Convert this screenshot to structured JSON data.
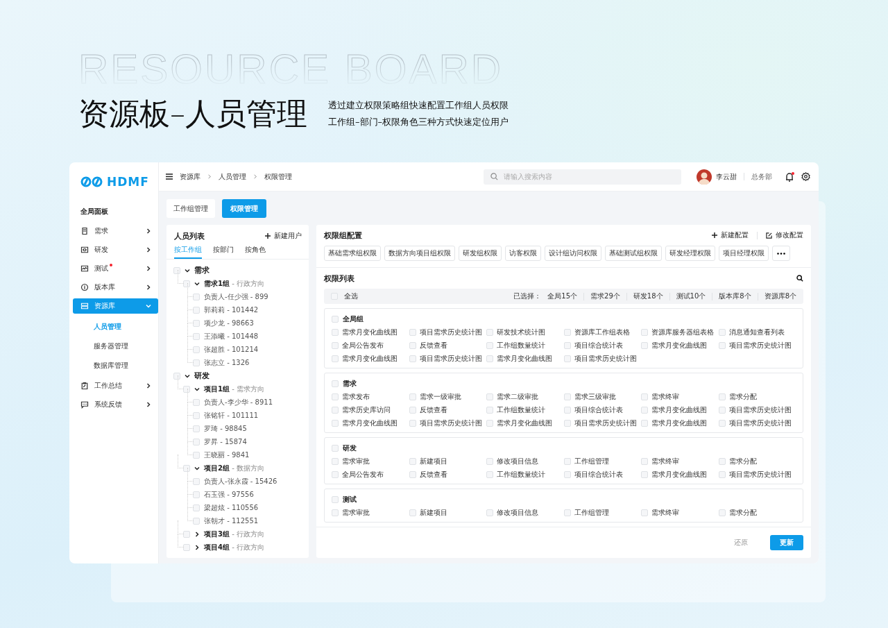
{
  "hero": {
    "backdrop_text": "RESOURCE BOARD",
    "title": "资源板–人员管理",
    "subtitle_lines": [
      "透过建立权限策略组快速配置工作组人员权限",
      "工作组–部门–权限角色三种方式快速定位用户"
    ]
  },
  "sidebar": {
    "logo": "HDMF",
    "heading": "全局面板",
    "items": [
      {
        "label": "需求",
        "dot": false,
        "selected": false,
        "expanded": false
      },
      {
        "label": "研发",
        "dot": false,
        "selected": false,
        "expanded": false
      },
      {
        "label": "测试",
        "dot": true,
        "selected": false,
        "expanded": false
      },
      {
        "label": "版本库",
        "dot": false,
        "selected": false,
        "expanded": false
      },
      {
        "label": "资源库",
        "dot": false,
        "selected": true,
        "expanded": true,
        "children": [
          {
            "label": "人员管理",
            "selected": true
          },
          {
            "label": "服务器管理",
            "selected": false
          },
          {
            "label": "数据库管理",
            "selected": false
          }
        ]
      },
      {
        "label": "工作总结",
        "dot": false,
        "selected": false,
        "expanded": false
      },
      {
        "label": "系统反馈",
        "dot": false,
        "selected": false,
        "expanded": false
      }
    ]
  },
  "header": {
    "breadcrumb": [
      "资源库",
      "人员管理",
      "权限管理"
    ],
    "search": {
      "placeholder": "请输入搜索内容"
    },
    "user": {
      "name": "李云甜",
      "department": "总务部"
    },
    "notifications_unread": true
  },
  "page_tabs": [
    {
      "label": "工作组管理",
      "selected": false
    },
    {
      "label": "权限管理",
      "selected": true
    }
  ],
  "people": {
    "title": "人员列表",
    "action": "新建用户",
    "tabs": [
      {
        "label": "按工作组",
        "selected": true
      },
      {
        "label": "按部门",
        "selected": false
      },
      {
        "label": "按角色",
        "selected": false
      }
    ],
    "tree": [
      {
        "label": "需求",
        "checked": false,
        "expanded": true,
        "children": [
          {
            "label": "**需求1组** - 行政方向",
            "checked": false,
            "expanded": true,
            "children": [
              {
                "label": "负责人-任少强 - 899",
                "checked": false
              },
              {
                "label": "郭莉莉 - 101442",
                "checked": false
              },
              {
                "label": "项少龙 - 98663",
                "checked": false
              },
              {
                "label": "王添曦 - 101448",
                "checked": false
              },
              {
                "label": "张超胜 - 101214",
                "checked": false
              },
              {
                "label": "张志立 - 1326",
                "checked": false
              }
            ]
          }
        ]
      },
      {
        "label": "研发",
        "checked": false,
        "expanded": true,
        "children": [
          {
            "label": "**项目1组** - 需求方向",
            "checked": false,
            "expanded": true,
            "children": [
              {
                "label": "负责人-李少华 - 8911",
                "checked": false
              },
              {
                "label": "张铭轩 - 101111",
                "checked": false
              },
              {
                "label": "罗琦 - 98845",
                "checked": false
              },
              {
                "label": "罗昇 - 15874",
                "checked": false
              },
              {
                "label": "王晓丽 - 9841",
                "checked": false
              }
            ]
          },
          {
            "label": "**项目2组** - 数据方向",
            "checked": false,
            "expanded": true,
            "children": [
              {
                "label": "负责人-张永霞 - 15426",
                "checked": false
              },
              {
                "label": "石玉强 - 97556",
                "checked": false
              },
              {
                "label": "梁超炫 - 110556",
                "checked": false
              },
              {
                "label": "张朝才 - 112551",
                "checked": false
              }
            ]
          },
          {
            "label": "**项目3组** - 行政方向",
            "checked": false,
            "expanded": false
          },
          {
            "label": "**项目4组** - 行政方向",
            "checked": false,
            "expanded": false
          }
        ]
      }
    ]
  },
  "permissions": {
    "title": "权限组配置",
    "actions": [
      "新建配置",
      "修改配置"
    ],
    "groups": [
      "基础需求组权限",
      "数据方向项目组权限",
      "研发组权限",
      "访客权限",
      "设计组访问权限",
      "基础测试组权限",
      "研发经理权限",
      "项目经理权限"
    ],
    "list_title": "权限列表",
    "select_all": {
      "label": "全选",
      "checked": false
    },
    "selected_label": "已选择：",
    "counts": [
      "全局15个",
      "需求29个",
      "研发18个",
      "测试10个",
      "版本库8个",
      "资源库8个"
    ],
    "sections": [
      {
        "title": "全局组",
        "checked": false,
        "items": [
          {
            "label": "需求月变化曲线图",
            "checked": false
          },
          {
            "label": "项目需求历史统计图",
            "checked": false
          },
          {
            "label": "研发技术统计图",
            "checked": false
          },
          {
            "label": "资源库工作组表格",
            "checked": false
          },
          {
            "label": "资源库服务器组表格",
            "checked": false
          },
          {
            "label": "消息通知查看列表",
            "checked": false
          },
          {
            "label": "全局公告发布",
            "checked": false
          },
          {
            "label": "反馈查看",
            "checked": false
          },
          {
            "label": "工作组数量统计",
            "checked": false
          },
          {
            "label": "项目综合统计表",
            "checked": false
          },
          {
            "label": "需求月变化曲线图",
            "checked": false
          },
          {
            "label": "项目需求历史统计图",
            "checked": false
          },
          {
            "label": "需求月变化曲线图",
            "checked": false
          },
          {
            "label": "项目需求历史统计图",
            "checked": false
          },
          {
            "label": "需求月变化曲线图",
            "checked": false
          },
          {
            "label": "项目需求历史统计图",
            "checked": false
          }
        ]
      },
      {
        "title": "需求",
        "checked": false,
        "items": [
          {
            "label": "需求发布",
            "checked": false
          },
          {
            "label": "需求一级审批",
            "checked": false
          },
          {
            "label": "需求二级审批",
            "checked": false
          },
          {
            "label": "需求三级审批",
            "checked": false
          },
          {
            "label": "需求终审",
            "checked": false
          },
          {
            "label": "需求分配",
            "checked": false
          },
          {
            "label": "需求历史库访问",
            "checked": false
          },
          {
            "label": "反馈查看",
            "checked": false
          },
          {
            "label": "工作组数量统计",
            "checked": false
          },
          {
            "label": "项目综合统计表",
            "checked": false
          },
          {
            "label": "需求月变化曲线图",
            "checked": false
          },
          {
            "label": "项目需求历史统计图",
            "checked": false
          },
          {
            "label": "需求月变化曲线图",
            "checked": false
          },
          {
            "label": "项目需求历史统计图",
            "checked": false
          },
          {
            "label": "需求月变化曲线图",
            "checked": false
          },
          {
            "label": "项目需求历史统计图",
            "checked": false
          },
          {
            "label": "需求月变化曲线图",
            "checked": false
          },
          {
            "label": "项目需求历史统计图",
            "checked": false
          }
        ]
      },
      {
        "title": "研发",
        "checked": false,
        "items": [
          {
            "label": "需求审批",
            "checked": false
          },
          {
            "label": "新建项目",
            "checked": false
          },
          {
            "label": "修改项目信息",
            "checked": false
          },
          {
            "label": "工作组管理",
            "checked": false
          },
          {
            "label": "需求终审",
            "checked": false
          },
          {
            "label": "需求分配",
            "checked": false
          },
          {
            "label": "全局公告发布",
            "checked": false
          },
          {
            "label": "反馈查看",
            "checked": false
          },
          {
            "label": "工作组数量统计",
            "checked": false
          },
          {
            "label": "项目综合统计表",
            "checked": false
          },
          {
            "label": "需求月变化曲线图",
            "checked": false
          },
          {
            "label": "项目需求历史统计图",
            "checked": false
          }
        ]
      },
      {
        "title": "测试",
        "checked": false,
        "items": [
          {
            "label": "需求审批",
            "checked": false
          },
          {
            "label": "新建项目",
            "checked": false
          },
          {
            "label": "修改项目信息",
            "checked": false
          },
          {
            "label": "工作组管理",
            "checked": false
          },
          {
            "label": "需求终审",
            "checked": false
          },
          {
            "label": "需求分配",
            "checked": false
          }
        ]
      }
    ]
  },
  "footer": {
    "reset": "还原",
    "submit": "更新"
  }
}
